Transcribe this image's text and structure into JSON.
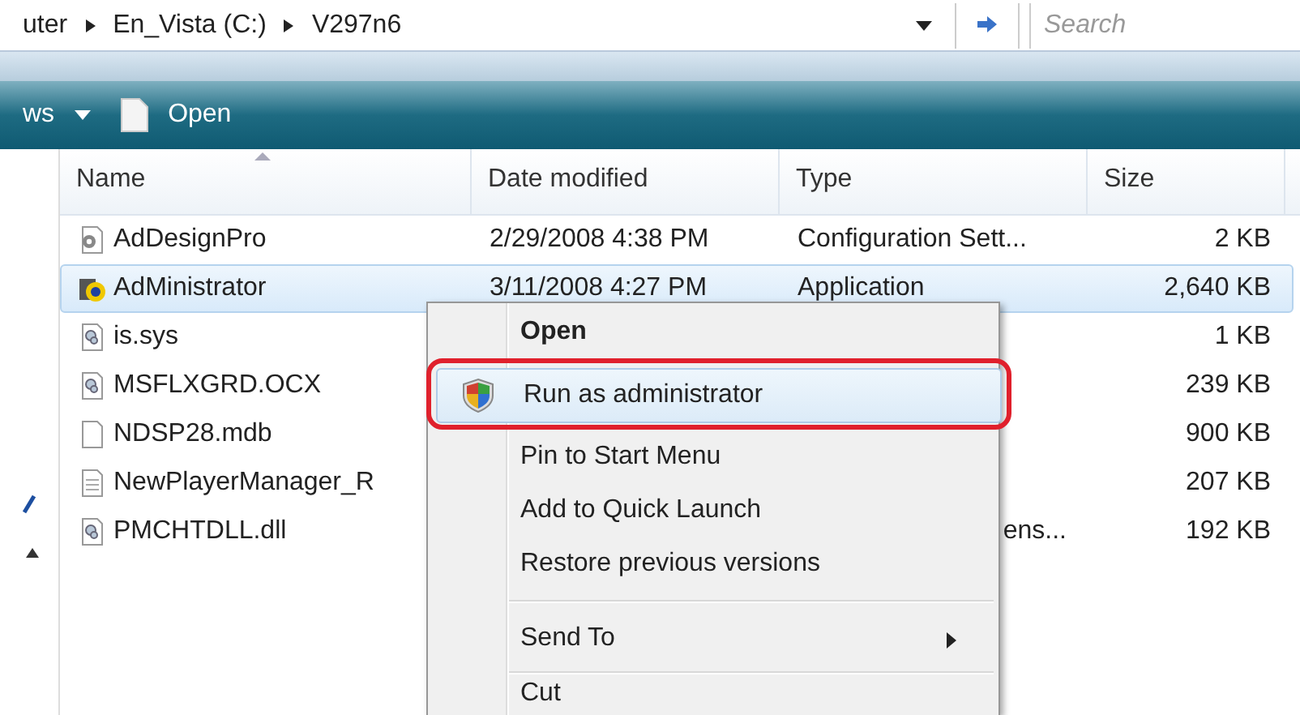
{
  "address_bar": {
    "crumbs": [
      "uter",
      "En_Vista (C:)",
      "V297n6"
    ],
    "search": {
      "placeholder": "Search"
    }
  },
  "toolbar": {
    "items": [
      {
        "label": "ws",
        "kind": "dropdown"
      },
      {
        "label": "Open",
        "kind": "document"
      }
    ]
  },
  "table": {
    "columns": [
      "Name",
      "Date modified",
      "Type",
      "Size"
    ],
    "rows": [
      {
        "kind": "settings",
        "name": "AdDesignPro",
        "date": "2/29/2008 4:38 PM",
        "type": "Configuration Sett...",
        "size": "2 KB",
        "selected": false
      },
      {
        "kind": "app",
        "name": "AdMinistrator",
        "date": "3/11/2008 4:27 PM",
        "type": "Application",
        "size": "2,640 KB",
        "selected": true
      },
      {
        "kind": "system",
        "name": "is.sys",
        "size": "1 KB",
        "selected": false
      },
      {
        "kind": "system",
        "name": "MSFLXGRD.OCX",
        "size": "239 KB",
        "selected": false
      },
      {
        "kind": "blank",
        "name": "NDSP28.mdb",
        "size": "900 KB",
        "selected": false
      },
      {
        "kind": "text",
        "name": "NewPlayerManager_R",
        "size": "207 KB",
        "selected": false
      },
      {
        "kind": "system",
        "name": "PMCHTDLL.dll",
        "type": "ens...",
        "size": "192 KB",
        "selected": false
      }
    ]
  },
  "context_menu": {
    "items": [
      {
        "kind": "item",
        "label": "Open",
        "bold": true,
        "selected": false
      },
      {
        "kind": "item",
        "label": "Run as administrator",
        "shield": true,
        "selected": true
      },
      {
        "kind": "item",
        "label": "Pin to Start Menu",
        "selected": false
      },
      {
        "kind": "item",
        "label": "Add to Quick Launch",
        "selected": false
      },
      {
        "kind": "item",
        "label": "Restore previous versions",
        "selected": false
      },
      {
        "kind": "separator"
      },
      {
        "kind": "item",
        "label": "Send To",
        "submenu": true,
        "selected": false
      },
      {
        "kind": "separator"
      },
      {
        "kind": "item",
        "label": "Cut",
        "selected": false
      }
    ]
  }
}
